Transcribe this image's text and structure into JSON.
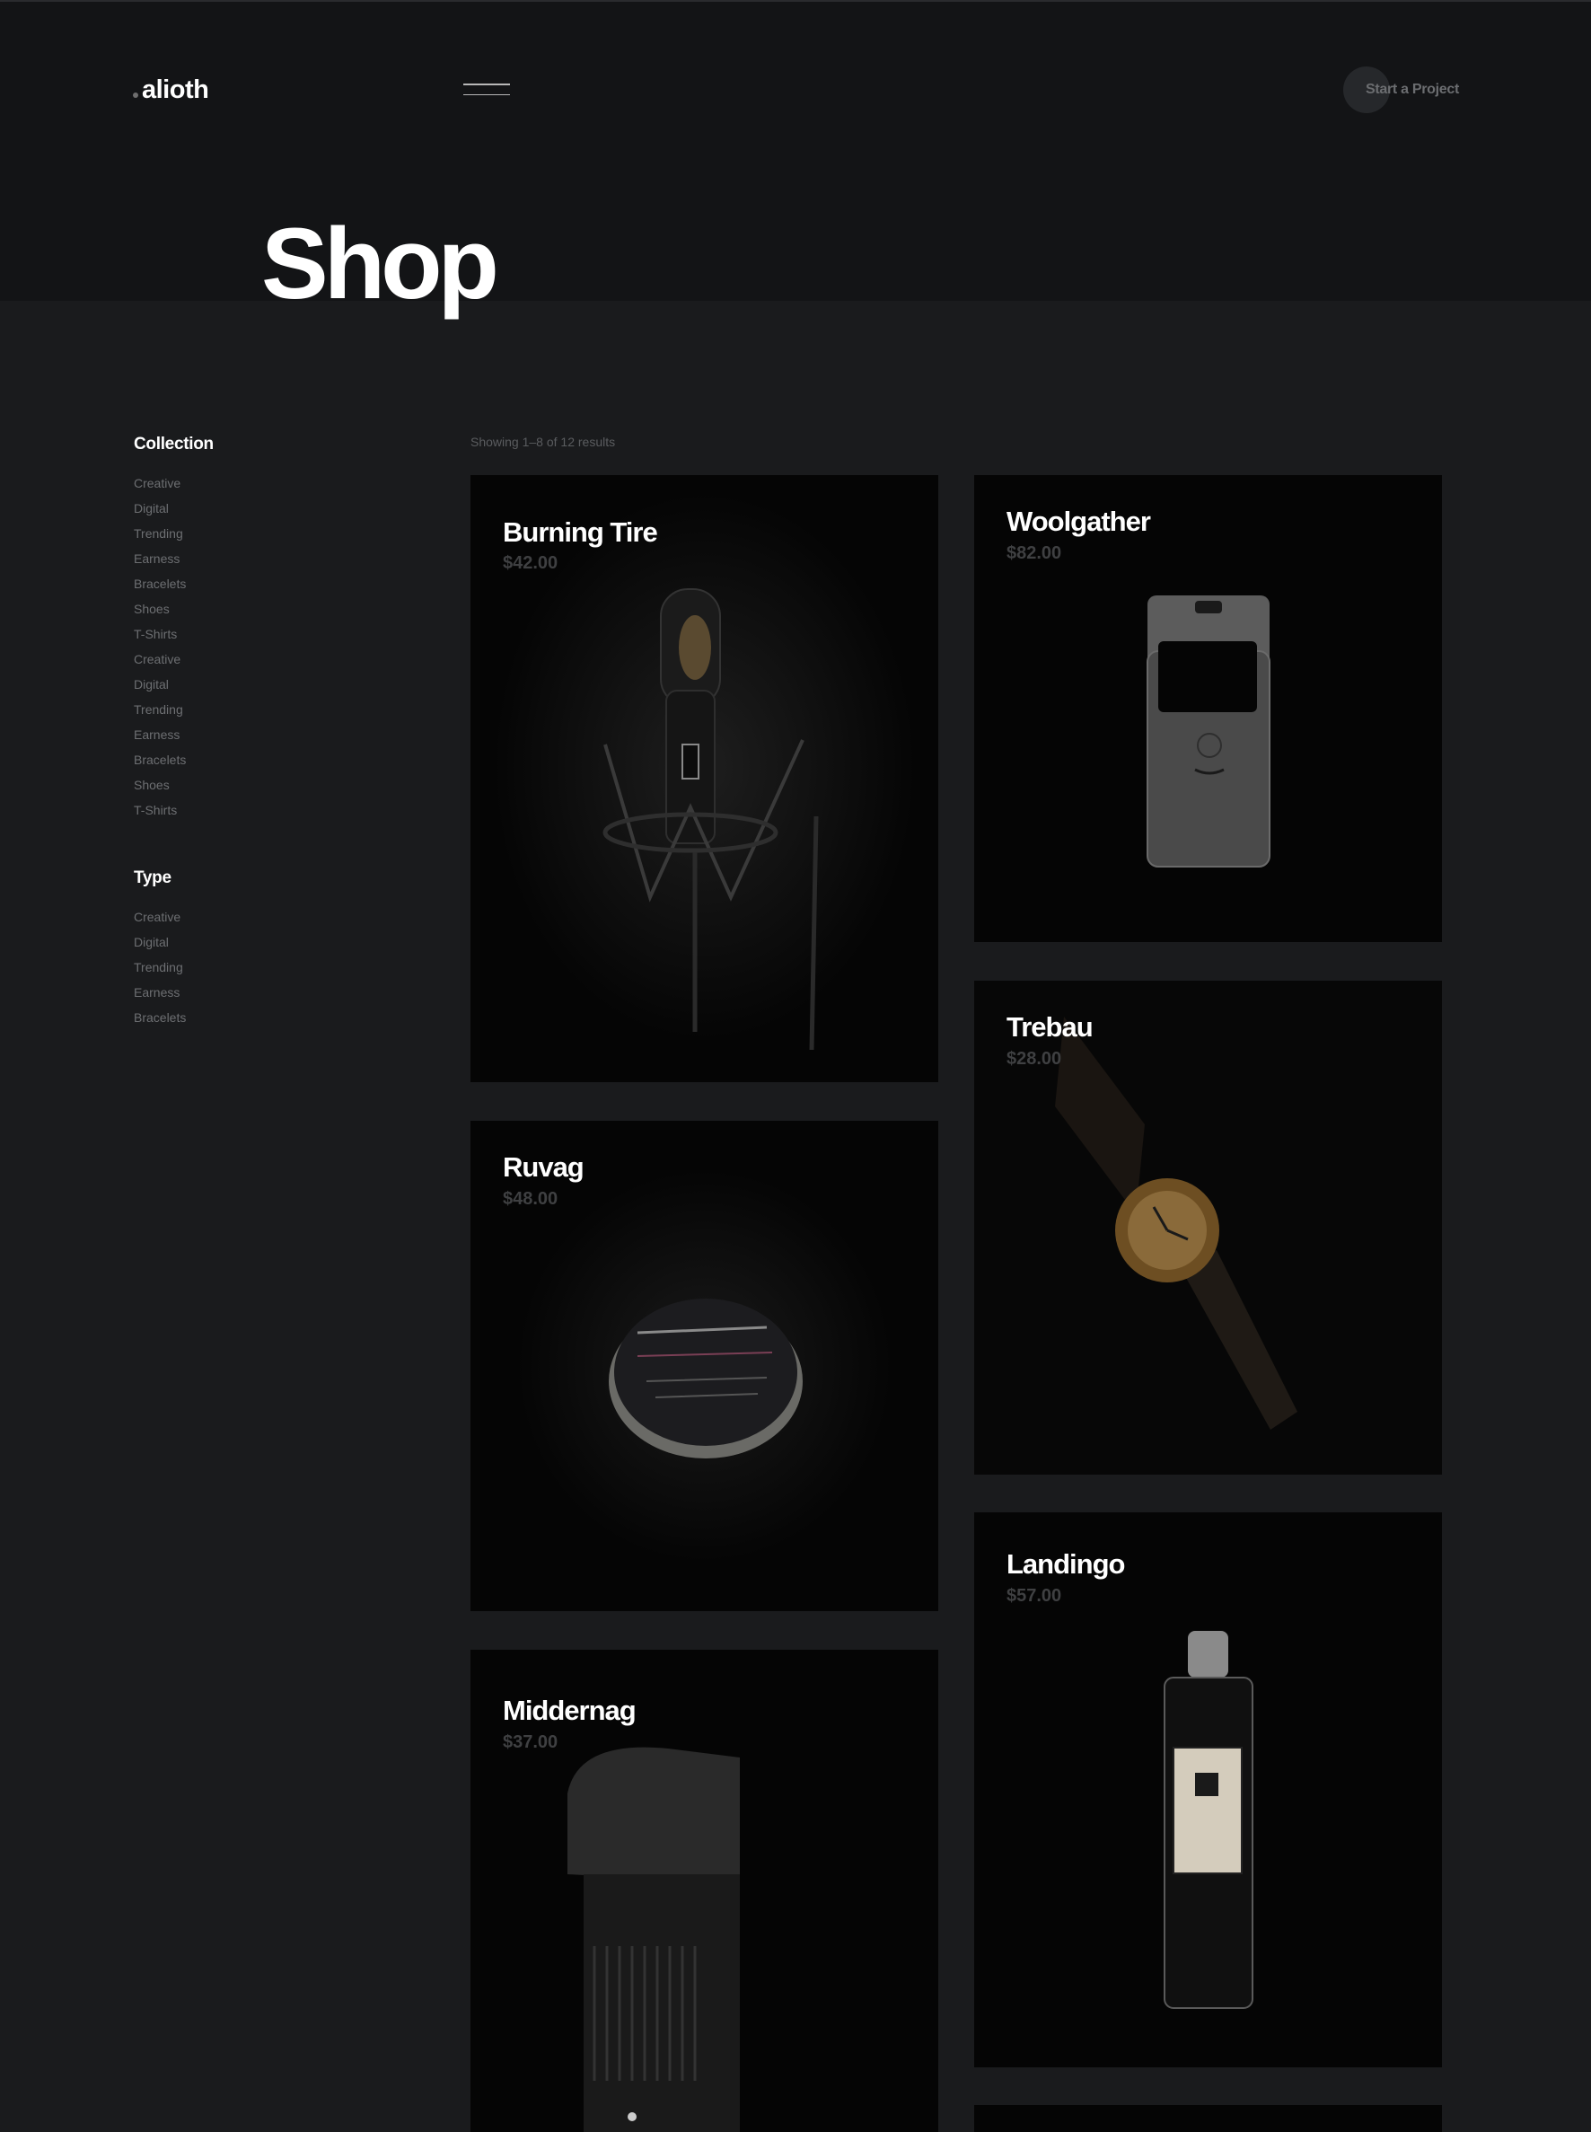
{
  "header": {
    "logo": "alioth",
    "cta_label": "Start a Project"
  },
  "page": {
    "title": "Shop"
  },
  "sidebar": {
    "collection": {
      "title": "Collection",
      "items": [
        "Creative",
        "Digital",
        "Trending",
        "Earness",
        "Bracelets",
        "Shoes",
        "T-Shirts",
        "Creative",
        "Digital",
        "Trending",
        "Earness",
        "Bracelets",
        "Shoes",
        "T-Shirts"
      ]
    },
    "type": {
      "title": "Type",
      "items": [
        "Creative",
        "Digital",
        "Trending",
        "Earness",
        "Bracelets"
      ]
    }
  },
  "shop": {
    "results": "Showing 1–8 of 12 results",
    "products": [
      {
        "name": "Burning Tire",
        "price": "$42.00",
        "image": "microphone"
      },
      {
        "name": "Woolgather",
        "price": "$82.00",
        "image": "flip-phone"
      },
      {
        "name": "Trebau",
        "price": "$28.00",
        "image": "wrist-watch"
      },
      {
        "name": "Ruvag",
        "price": "$48.00",
        "image": "pomade-tin"
      },
      {
        "name": "Landingo",
        "price": "$57.00",
        "image": "cologne-bottle"
      },
      {
        "name": "Middernag",
        "price": "$37.00",
        "image": "camera-lens"
      }
    ]
  },
  "colors": {
    "background": "#1a1b1d",
    "header_band": "#131416",
    "card": "#050505",
    "muted_text": "#6d6f72",
    "price_text": "#3f4042"
  }
}
